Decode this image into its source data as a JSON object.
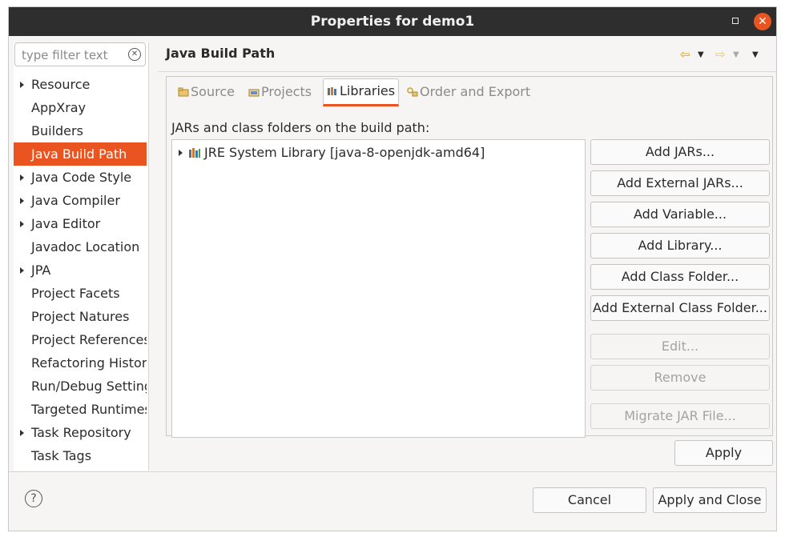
{
  "window": {
    "title": "Properties for demo1"
  },
  "filter": {
    "placeholder": "type filter text"
  },
  "tree": [
    {
      "label": "Resource",
      "expandable": true,
      "selected": false
    },
    {
      "label": "AppXray",
      "expandable": false,
      "selected": false
    },
    {
      "label": "Builders",
      "expandable": false,
      "selected": false
    },
    {
      "label": "Java Build Path",
      "expandable": false,
      "selected": true
    },
    {
      "label": "Java Code Style",
      "expandable": true,
      "selected": false
    },
    {
      "label": "Java Compiler",
      "expandable": true,
      "selected": false
    },
    {
      "label": "Java Editor",
      "expandable": true,
      "selected": false
    },
    {
      "label": "Javadoc Location",
      "expandable": false,
      "selected": false
    },
    {
      "label": "JPA",
      "expandable": true,
      "selected": false
    },
    {
      "label": "Project Facets",
      "expandable": false,
      "selected": false
    },
    {
      "label": "Project Natures",
      "expandable": false,
      "selected": false
    },
    {
      "label": "Project References",
      "expandable": false,
      "selected": false
    },
    {
      "label": "Refactoring History",
      "expandable": false,
      "selected": false
    },
    {
      "label": "Run/Debug Settings",
      "expandable": false,
      "selected": false
    },
    {
      "label": "Targeted Runtimes",
      "expandable": false,
      "selected": false
    },
    {
      "label": "Task Repository",
      "expandable": true,
      "selected": false
    },
    {
      "label": "Task Tags",
      "expandable": false,
      "selected": false
    }
  ],
  "page": {
    "title": "Java Build Path"
  },
  "tabs": [
    {
      "label": "Source",
      "icon": "source-folder-icon",
      "active": false
    },
    {
      "label": "Projects",
      "icon": "project-icon",
      "active": false
    },
    {
      "label": "Libraries",
      "icon": "library-icon",
      "active": true
    },
    {
      "label": "Order and Export",
      "icon": "order-export-icon",
      "active": false
    }
  ],
  "libraries": {
    "section_label": "JARs and class folders on the build path:",
    "entries": [
      {
        "label": "JRE System Library [java-8-openjdk-amd64]",
        "icon": "library-icon"
      }
    ]
  },
  "side_buttons": [
    {
      "label": "Add JARs...",
      "enabled": true
    },
    {
      "label": "Add External JARs...",
      "enabled": true
    },
    {
      "label": "Add Variable...",
      "enabled": true
    },
    {
      "label": "Add Library...",
      "enabled": true
    },
    {
      "label": "Add Class Folder...",
      "enabled": true
    },
    {
      "label": "Add External Class Folder...",
      "enabled": true
    },
    {
      "label": "Edit...",
      "enabled": false
    },
    {
      "label": "Remove",
      "enabled": false
    },
    {
      "label": "Migrate JAR File...",
      "enabled": false
    }
  ],
  "footer": {
    "apply": "Apply",
    "cancel": "Cancel",
    "apply_close": "Apply and Close"
  },
  "colors": {
    "accent": "#e95420",
    "titlebar": "#2e2e2e"
  }
}
